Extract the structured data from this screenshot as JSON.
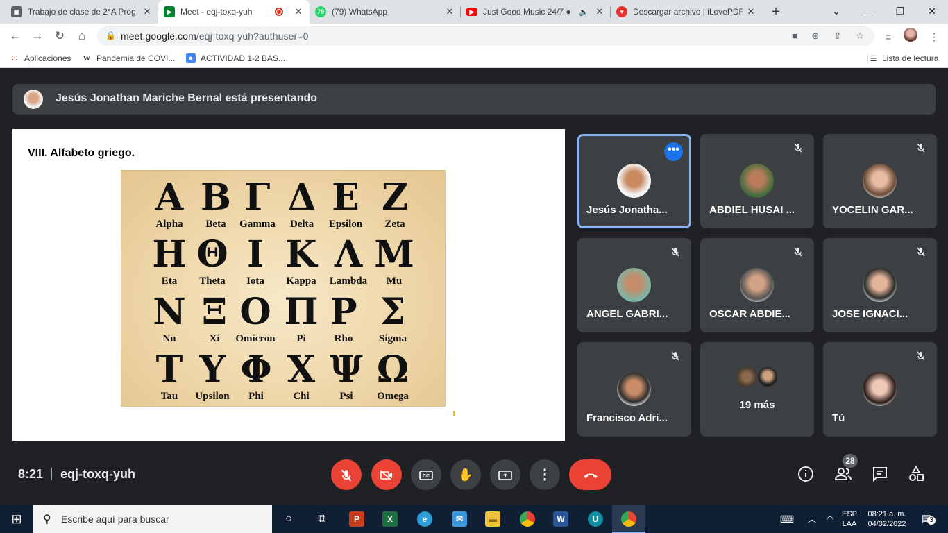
{
  "browser": {
    "tabs": [
      {
        "label": "Trabajo de clase de 2°A Prog",
        "favicon_color": "#5f6368"
      },
      {
        "label": "Meet - eqj-toxq-yuh",
        "favicon_color": "#00832d",
        "active": true,
        "recording": true
      },
      {
        "label": "(79) WhatsApp",
        "favicon_color": "#25d366",
        "badge": "79"
      },
      {
        "label": "Just Good Music 24/7 ●",
        "favicon_color": "#ff0000",
        "audio": true
      },
      {
        "label": "Descargar archivo | iLovePDF",
        "favicon_color": "#e5322d"
      }
    ],
    "tab_close": "✕",
    "new_tab": "+",
    "url_host": "meet.google.com",
    "url_path": "/eqj-toxq-yuh?authuser=0",
    "bookmarks": [
      {
        "label": "Aplicaciones"
      },
      {
        "label": "Pandemia de COVI..."
      },
      {
        "label": "ACTIVIDAD 1-2 BAS..."
      }
    ],
    "reading_list": "Lista de lectura"
  },
  "meet": {
    "presenting_banner": "Jesús Jonathan Mariche Bernal está presentando",
    "slide_title": "VIII. Alfabeto griego.",
    "greek_rows": [
      [
        {
          "g": "Α",
          "n": "Alpha"
        },
        {
          "g": "Β",
          "n": "Beta"
        },
        {
          "g": "Γ",
          "n": "Gamma"
        },
        {
          "g": "Δ",
          "n": "Delta"
        },
        {
          "g": "Ε",
          "n": "Epsilon"
        },
        {
          "g": "Ζ",
          "n": "Zeta"
        }
      ],
      [
        {
          "g": "Η",
          "n": "Eta"
        },
        {
          "g": "Θ",
          "n": "Theta"
        },
        {
          "g": "Ι",
          "n": "Iota"
        },
        {
          "g": "Κ",
          "n": "Kappa"
        },
        {
          "g": "Λ",
          "n": "Lambda"
        },
        {
          "g": "Μ",
          "n": "Mu"
        }
      ],
      [
        {
          "g": "Ν",
          "n": "Nu"
        },
        {
          "g": "Ξ",
          "n": "Xi"
        },
        {
          "g": "Ο",
          "n": "Omicron"
        },
        {
          "g": "Π",
          "n": "Pi"
        },
        {
          "g": "Ρ",
          "n": "Rho"
        },
        {
          "g": "Σ",
          "n": "Sigma"
        }
      ],
      [
        {
          "g": "Τ",
          "n": "Tau"
        },
        {
          "g": "Υ",
          "n": "Upsilon"
        },
        {
          "g": "Φ",
          "n": "Phi"
        },
        {
          "g": "Χ",
          "n": "Chi"
        },
        {
          "g": "Ψ",
          "n": "Psi"
        },
        {
          "g": "Ω",
          "n": "Omega"
        }
      ]
    ],
    "participants": [
      {
        "name": "Jesús Jonatha...",
        "speaking": true,
        "muted": false
      },
      {
        "name": "ABDIEL HUSAI ...",
        "muted": true
      },
      {
        "name": "YOCELIN GAR...",
        "muted": true
      },
      {
        "name": "ANGEL GABRI...",
        "muted": true
      },
      {
        "name": "OSCAR ABDIE...",
        "muted": true
      },
      {
        "name": "JOSE IGNACI...",
        "muted": true
      },
      {
        "name": "Francisco Adri...",
        "muted": true
      },
      {
        "name": "Tú",
        "muted": true
      }
    ],
    "more_participants": "19 más",
    "time": "8:21",
    "meeting_code": "eqj-toxq-yuh",
    "participant_count": "28"
  },
  "taskbar": {
    "search_placeholder": "Escribe aquí para buscar",
    "lang_top": "ESP",
    "lang_bottom": "LAA",
    "clock_time": "08:21 a. m.",
    "clock_date": "04/02/2022",
    "notif_count": "3"
  }
}
